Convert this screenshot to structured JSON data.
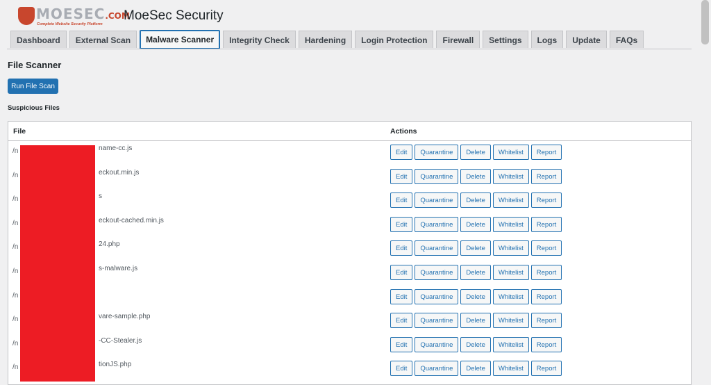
{
  "header": {
    "logo_text": "MOESEC",
    "logo_suffix": ".COM",
    "logo_tagline": "Complete Website Security Platform",
    "app_title": "MoeSec Security"
  },
  "tabs": [
    {
      "label": "Dashboard"
    },
    {
      "label": "External Scan"
    },
    {
      "label": "Malware Scanner",
      "active": true
    },
    {
      "label": "Integrity Check"
    },
    {
      "label": "Hardening"
    },
    {
      "label": "Login Protection"
    },
    {
      "label": "Firewall"
    },
    {
      "label": "Settings"
    },
    {
      "label": "Logs"
    },
    {
      "label": "Update"
    },
    {
      "label": "FAQs"
    }
  ],
  "main": {
    "section_title": "File Scanner",
    "run_button": "Run File Scan",
    "subheading": "Suspicious Files",
    "table": {
      "col_file": "File",
      "col_actions": "Actions",
      "rows": [
        {
          "prefix": "/n",
          "suffix": "name-cc.js"
        },
        {
          "prefix": "/n",
          "suffix": "eckout.min.js"
        },
        {
          "prefix": "/n",
          "suffix": "s"
        },
        {
          "prefix": "/n",
          "suffix": "eckout-cached.min.js"
        },
        {
          "prefix": "/n",
          "suffix": "24.php"
        },
        {
          "prefix": "/n",
          "suffix": "s-malware.js"
        },
        {
          "prefix": "/n",
          "suffix": ""
        },
        {
          "prefix": "/n",
          "suffix": "vare-sample.php"
        },
        {
          "prefix": "/n",
          "suffix": "-CC-Stealer.js"
        },
        {
          "prefix": "/n",
          "suffix": "tionJS.php"
        }
      ],
      "actions": [
        "Edit",
        "Quarantine",
        "Delete",
        "Whitelist",
        "Report"
      ]
    }
  },
  "colors": {
    "accent": "#2271b1",
    "redaction": "#ed1c24",
    "brand": "#c8462d"
  }
}
